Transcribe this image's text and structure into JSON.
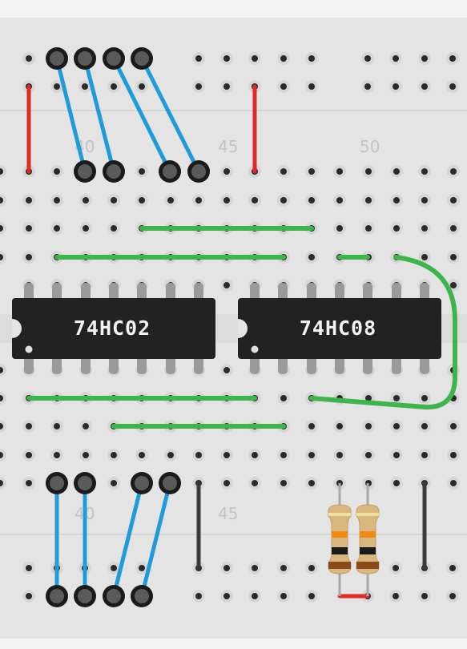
{
  "column_labels": {
    "top": [
      "40",
      "45",
      "50"
    ],
    "bottom": [
      "40",
      "45"
    ]
  },
  "chips": [
    {
      "part": "74HC02"
    },
    {
      "part": "74HC08"
    }
  ],
  "colors": {
    "board": "#e4e4e4",
    "board_edge": "#f4f4f4",
    "hole": "#2a2a2a",
    "hole_ring": "#d0d0d0",
    "chip_body": "#222222",
    "chip_pin": "#9a9a9a",
    "wire_blue": "#1e9bd8",
    "wire_green": "#3db54a",
    "wire_red": "#e02a2a",
    "wire_black": "#3a3a3a",
    "resistor_body": "#d9b77e",
    "resistor_band_orange": "#f08a12",
    "resistor_band_black": "#1b1b1b",
    "resistor_band_brown": "#8a4a1a"
  },
  "components": {
    "resistors": [
      {
        "bands": [
          "orange",
          "orange",
          "black",
          "brown"
        ]
      },
      {
        "bands": [
          "orange",
          "orange",
          "black",
          "brown"
        ]
      }
    ]
  }
}
